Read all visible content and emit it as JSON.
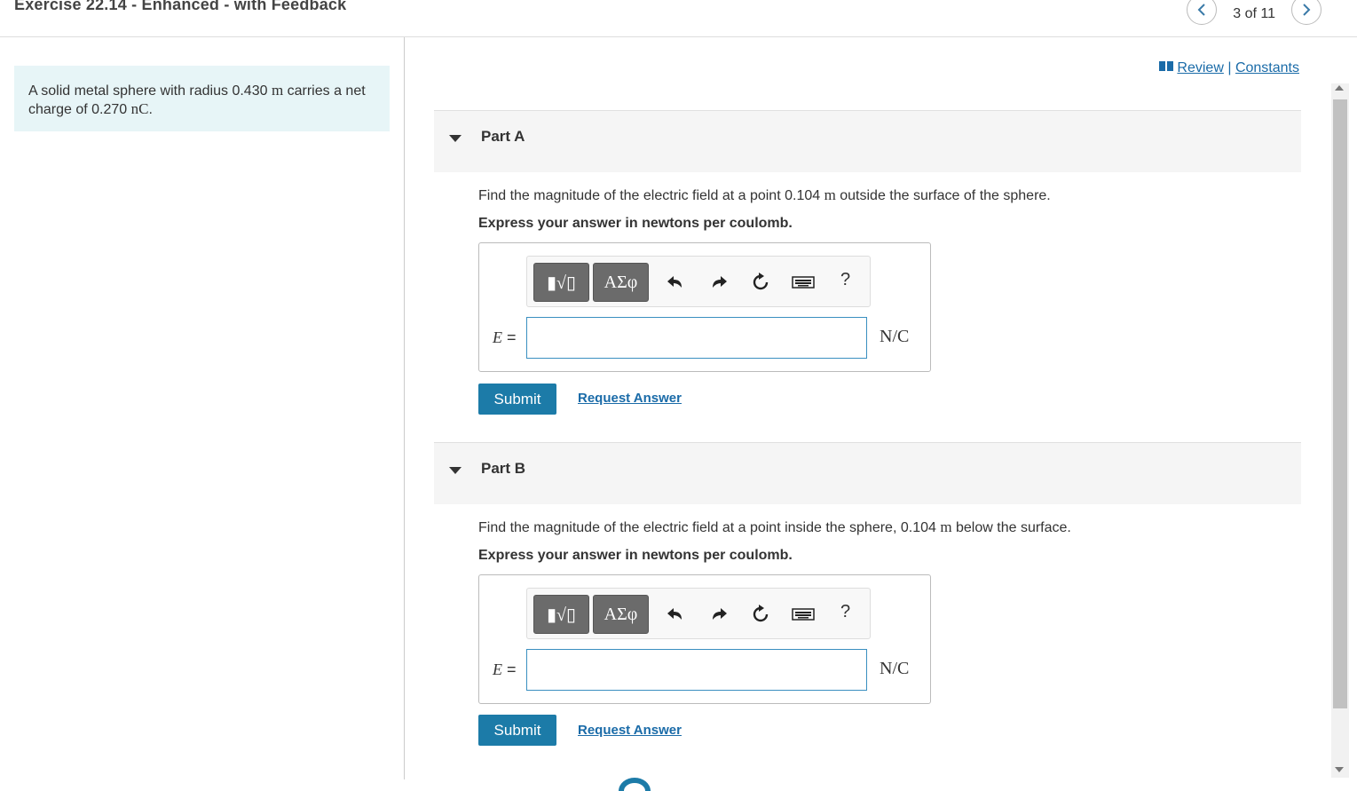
{
  "header": {
    "title": "Exercise 22.14 - Enhanced - with Feedback",
    "prev_icon": "chevron-left-icon",
    "next_icon": "chevron-right-icon",
    "pager_text": "3 of 11"
  },
  "links": {
    "review": "Review",
    "separator": "|",
    "constants": "Constants"
  },
  "intro": {
    "text_before": "A solid metal sphere with radius 0.430 ",
    "unit_m": "m",
    "text_middle": " carries a net charge of 0.270 ",
    "unit_nc": "nC",
    "text_end": "."
  },
  "parts": [
    {
      "title": "Part A",
      "question_before": "Find the magnitude of the electric field at a point 0.104 ",
      "question_unit": "m",
      "question_after": " outside the surface of the sphere.",
      "instruction": "Express your answer in newtons per coulomb.",
      "variable": "E",
      "equals": " =",
      "answer_value": "",
      "units": "N/C",
      "submit_label": "Submit",
      "request_label": "Request Answer"
    },
    {
      "title": "Part B",
      "question_before": "Find the magnitude of the electric field at a point inside the sphere, 0.104 ",
      "question_unit": "m",
      "question_after": " below the surface.",
      "instruction": "Express your answer in newtons per coulomb.",
      "variable": "E",
      "equals": " =",
      "answer_value": "",
      "units": "N/C",
      "submit_label": "Submit",
      "request_label": "Request Answer"
    }
  ],
  "toolbar": {
    "templates_label": "▮√▯",
    "greek_label": "ΑΣφ",
    "undo_icon": "undo-icon",
    "redo_icon": "redo-icon",
    "reset_icon": "reset-icon",
    "keyboard_icon": "keyboard-icon",
    "help_label": "?"
  },
  "colors": {
    "accent": "#1c7ba8",
    "intro_bg": "#e7f5f7",
    "toolbar_button": "#6b6b6b"
  }
}
